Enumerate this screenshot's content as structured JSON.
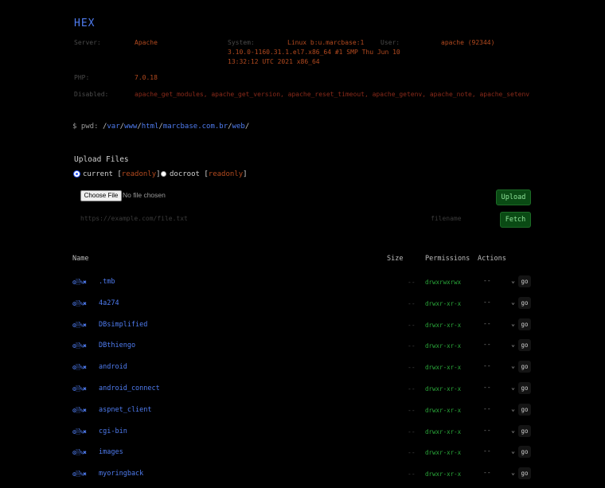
{
  "header": {
    "title": "HEX",
    "server_label": "Server:",
    "server_value": "Apache",
    "system_label": "System:",
    "system_value_line1": "Linux b:u.marcbase:1",
    "system_value_line2": "3.10.0-1160.31.1.el7.x86_64 #1 SMP Thu Jun 10",
    "system_value_line3": "13:32:12 UTC 2021 x86_64",
    "user_label": "User:",
    "user_value": "apache (92344)",
    "php_label": "PHP:",
    "php_value": "7.0.18",
    "disabled_label": "Disabled:",
    "disabled_value": "apache_get_modules, apache_get_version, apache_reset_timeout, apache_getenv, apache_note, apache_setenv"
  },
  "path": {
    "prefix": "$ pwd:",
    "segments": [
      "var",
      "www",
      "html",
      "marcbase.com.br",
      "web"
    ]
  },
  "upload": {
    "title": "Upload Files",
    "radio_current": "current",
    "radio_docroot": "docroot",
    "readonly": "readonly",
    "choose_file": "Choose File",
    "no_file": "No file chosen",
    "upload_button": "Upload",
    "url_placeholder": "https://example.com/file.txt",
    "filename_placeholder": "filename",
    "fetch_button": "Fetch"
  },
  "table": {
    "headers": {
      "name": "Name",
      "size": "Size",
      "permissions": "Permissions",
      "actions": "Actions"
    },
    "rows": [
      {
        "name": ".tmb",
        "size": "--",
        "perm": "drwxrwxrwx",
        "action": "--",
        "go": "go"
      },
      {
        "name": "4a274",
        "size": "--",
        "perm": "drwxr-xr-x",
        "action": "--",
        "go": "go"
      },
      {
        "name": "DBsimplified",
        "size": "--",
        "perm": "drwxr-xr-x",
        "action": "--",
        "go": "go"
      },
      {
        "name": "DBthiengo",
        "size": "--",
        "perm": "drwxr-xr-x",
        "action": "--",
        "go": "go"
      },
      {
        "name": "android",
        "size": "--",
        "perm": "drwxr-xr-x",
        "action": "--",
        "go": "go"
      },
      {
        "name": "android_connect",
        "size": "--",
        "perm": "drwxr-xr-x",
        "action": "--",
        "go": "go"
      },
      {
        "name": "aspnet_client",
        "size": "--",
        "perm": "drwxr-xr-x",
        "action": "--",
        "go": "go"
      },
      {
        "name": "cgi-bin",
        "size": "--",
        "perm": "drwxr-xr-x",
        "action": "--",
        "go": "go"
      },
      {
        "name": "images",
        "size": "--",
        "perm": "drwxr-xr-x",
        "action": "--",
        "go": "go"
      },
      {
        "name": "myoringback",
        "size": "--",
        "perm": "drwxr-xr-x",
        "action": "--",
        "go": "go"
      }
    ]
  },
  "colors": {
    "accent": "#4f7cf0",
    "red": "#b34a1f",
    "green": "#2aa83a",
    "button_green": "#0a4a14"
  },
  "icons": {
    "row_icons": "folder-actions-icons",
    "select": "chevron-down-icon"
  }
}
